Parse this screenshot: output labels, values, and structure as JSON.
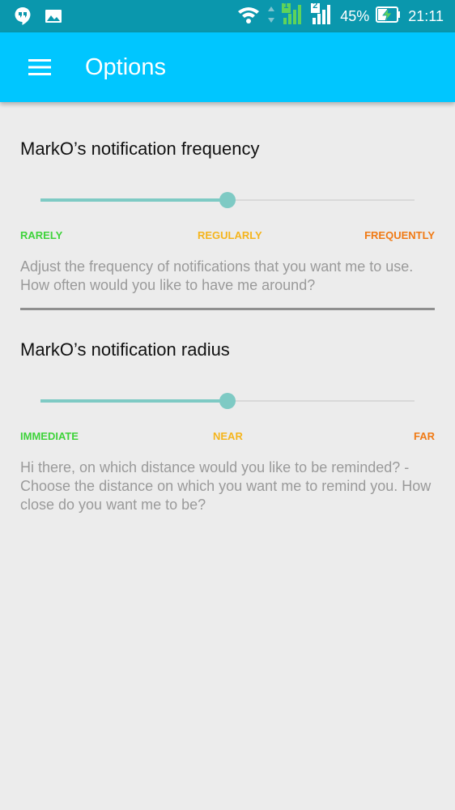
{
  "status_bar": {
    "battery_percent": "45%",
    "time": "21:11",
    "sim1_label": "1",
    "sim2_label": "2",
    "icons": [
      "hangouts-icon",
      "gallery-icon",
      "wifi-icon",
      "signal-icon",
      "battery-charging-icon"
    ]
  },
  "app_bar": {
    "title": "Options",
    "menu_icon": "hamburger-menu-icon",
    "color": "#00c6ff"
  },
  "frequency": {
    "title": "MarkO’s notification frequency",
    "slider_value": 0.5,
    "labels": [
      {
        "text": "RARELY",
        "color": "#3fd33b"
      },
      {
        "text": "REGULARLY",
        "color": "#f5b51d"
      },
      {
        "text": "FREQUENTLY",
        "color": "#f07a15"
      }
    ],
    "description": "Adjust the frequency of notifications that you want me to use. How often would you like to have me around?"
  },
  "radius": {
    "title": "MarkO’s notification radius",
    "slider_value": 0.5,
    "labels": [
      {
        "text": "IMMEDIATE",
        "color": "#3fd33b"
      },
      {
        "text": "NEAR",
        "color": "#f5b51d"
      },
      {
        "text": "FAR",
        "color": "#f07a15"
      }
    ],
    "description": "Hi there, on which distance would you like to be reminded? - Choose the distance on which you want me to remind you. How close do you want me to be?"
  }
}
